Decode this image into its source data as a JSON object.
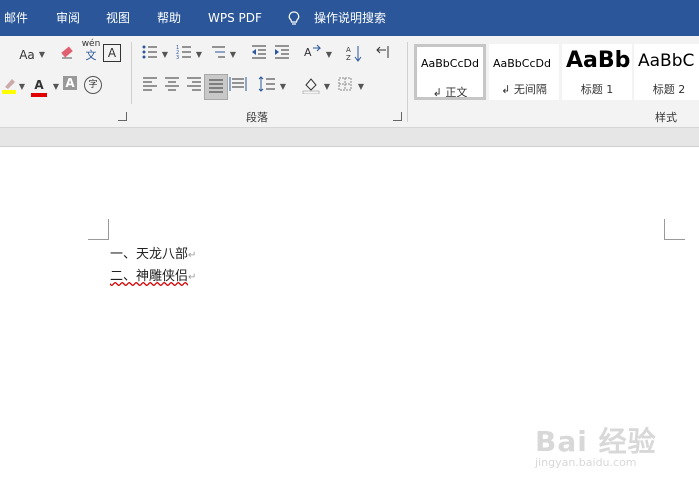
{
  "menu": {
    "items": [
      "邮件",
      "审阅",
      "视图",
      "帮助",
      "WPS PDF"
    ],
    "search": "操作说明搜索"
  },
  "ribbon": {
    "font_size_btn": "Aa",
    "phonetic_top": "wén",
    "phonetic_bottom": "文",
    "char_border": "A",
    "shading_char": "A",
    "enclose_char": "字",
    "paragraph_label": "段落",
    "styles_label": "样式",
    "styles": [
      {
        "sample": "AaBbCcDd",
        "name": "正文"
      },
      {
        "sample": "AaBbCcDd",
        "name": "无间隔"
      },
      {
        "sample": "AaBb",
        "name": "标题 1"
      },
      {
        "sample": "AaBbC",
        "name": "标题 2"
      }
    ]
  },
  "document": {
    "lines": [
      "一、天龙八部",
      "二、神雕侠侣"
    ],
    "para_mark": "↵"
  },
  "watermark": {
    "main": "Bai 经验",
    "sub": "jingyan.baidu.com"
  },
  "colors": {
    "menubar": "#2b579a",
    "ribbon": "#f3f3f3",
    "font_color_bar": "#e00000",
    "highlight_bar": "#ffff00"
  }
}
